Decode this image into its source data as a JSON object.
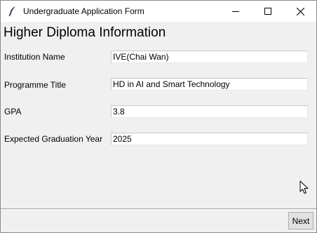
{
  "window": {
    "title": "Undergraduate Application Form",
    "app_icon": "feather-icon",
    "controls": [
      "minimize-icon",
      "maximize-icon",
      "close-icon"
    ]
  },
  "form": {
    "heading": "Higher Diploma Information",
    "fields": [
      {
        "label": "Institution Name",
        "value": "IVE(Chai Wan)"
      },
      {
        "label": "Programme Title",
        "value": "HD in AI and Smart Technology"
      },
      {
        "label": "GPA",
        "value": "3.8"
      },
      {
        "label": "Expected Graduation Year",
        "value": "2025"
      }
    ]
  },
  "footer": {
    "next_label": "Next"
  }
}
